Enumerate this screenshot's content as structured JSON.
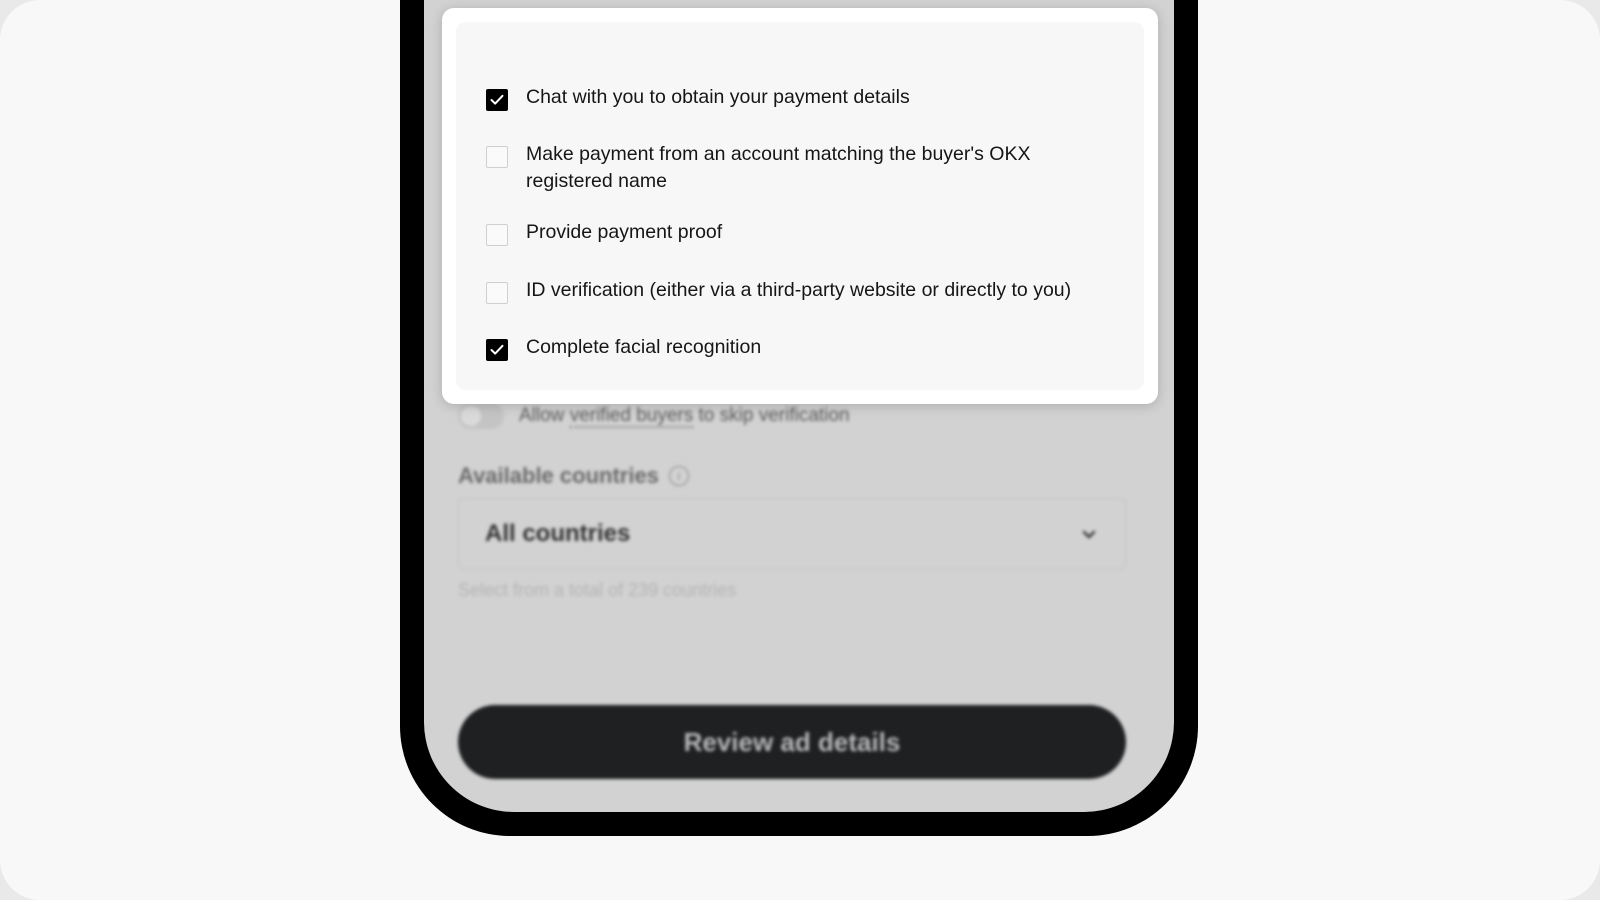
{
  "modal": {
    "options": [
      {
        "label": "Chat with you to obtain your payment details",
        "checked": true
      },
      {
        "label": "Make payment from an account matching the buyer's OKX registered name",
        "checked": false
      },
      {
        "label": "Provide payment proof",
        "checked": false
      },
      {
        "label": "ID verification (either via a third-party website or directly to you)",
        "checked": false
      },
      {
        "label": "Complete facial recognition",
        "checked": true
      }
    ]
  },
  "background": {
    "toggle_label_pre": "Allow ",
    "toggle_label_link": "verified buyers",
    "toggle_label_post": " to skip verification",
    "toggle_on": false,
    "countries_label": "Available countries",
    "countries_value": "All countries",
    "countries_helper": "Select from a total of 239 countries",
    "review_button": "Review ad details"
  },
  "colors": {
    "checkbox_checked": "#000000",
    "button_bg": "#1e2022"
  },
  "icons": [
    "check-icon",
    "info-icon",
    "chevron-down-icon"
  ]
}
